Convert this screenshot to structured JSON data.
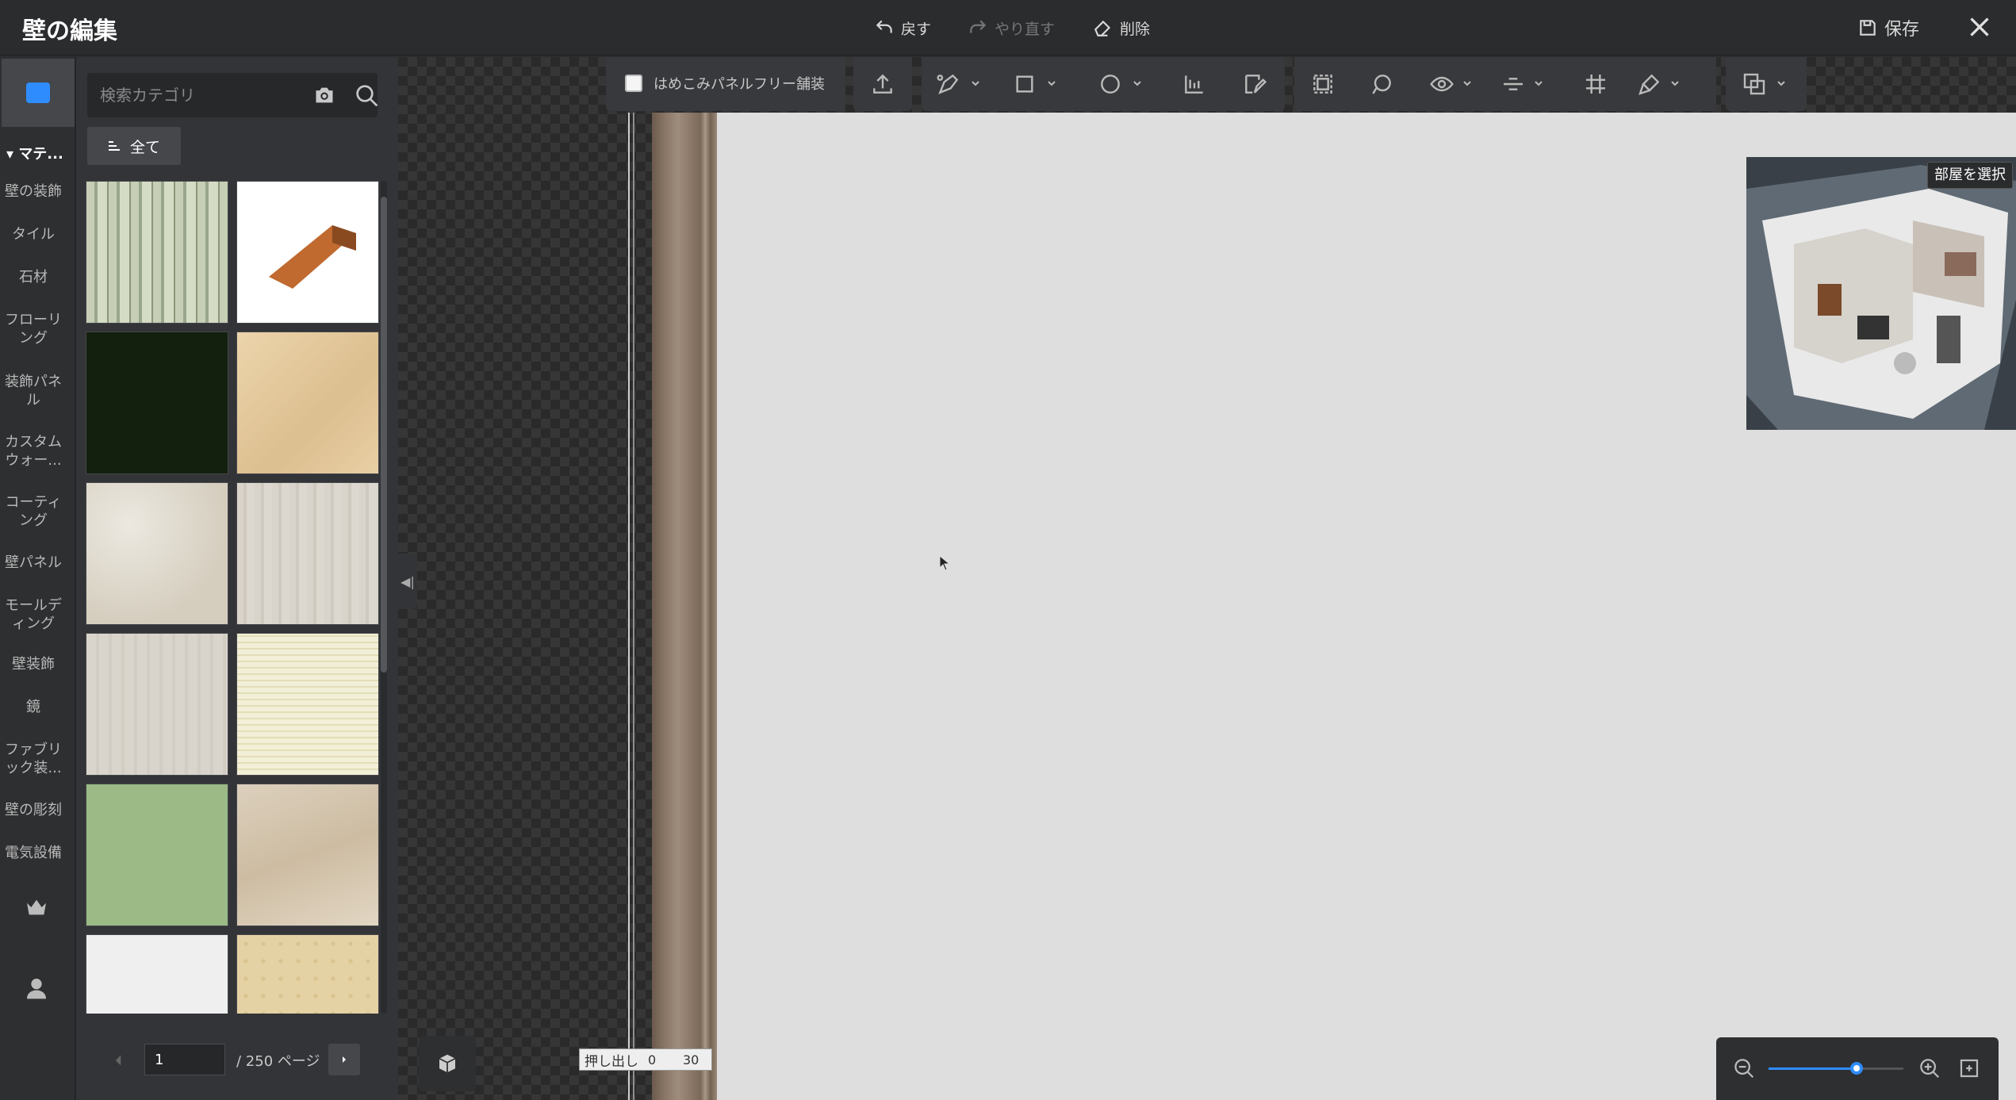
{
  "header": {
    "title": "壁の編集",
    "undo_label": "戻す",
    "redo_label": "やり直す",
    "delete_label": "削除",
    "save_label": "保存"
  },
  "sidebar": {
    "category_header": "マテ...",
    "categories": [
      "壁の装飾",
      "タイル",
      "石材",
      "フローリ\nング",
      "装飾パネ\nル",
      "カスタム\nウォー...",
      "コーティ\nング",
      "壁パネル",
      "モールデ\nィング",
      "壁装飾",
      "鏡",
      "ファブリ\nック装...",
      "壁の彫刻",
      "電気設備"
    ]
  },
  "materials": {
    "search_placeholder": "検索カテゴリ",
    "filter_label": "全て",
    "tiles": [
      {
        "name": "birch-wood",
        "color": "#b8c2aa"
      },
      {
        "name": "wood-baseboard",
        "color": "#ffffff"
      },
      {
        "name": "dark-green",
        "color": "#14200e"
      },
      {
        "name": "light-oak",
        "color": "#e6cba0"
      },
      {
        "name": "beige-stone",
        "color": "#ddd7cb"
      },
      {
        "name": "grey-wood",
        "color": "#d6d1c8"
      },
      {
        "name": "pale-wood",
        "color": "#d8d3c9"
      },
      {
        "name": "check-fabric",
        "color": "#f2efd8"
      },
      {
        "name": "green-plaster",
        "color": "#9bba86"
      },
      {
        "name": "marble-tile",
        "color": "#d8cbb6"
      },
      {
        "name": "white-plaster",
        "color": "#efefef"
      },
      {
        "name": "damask-wallpaper",
        "color": "#e4d1a4"
      }
    ],
    "pagination": {
      "current": "1",
      "total_label": "/ 250 ページ"
    }
  },
  "toolbar": {
    "inlay_panel_label": "はめこみパネルフリー舗装"
  },
  "minimap": {
    "room_select_label": "部屋を選択"
  },
  "extrude": {
    "label": "押し出し",
    "value_a": "0",
    "value_b": "30"
  },
  "zoom": {
    "level": 0.65
  },
  "colors": {
    "accent": "#2f8cff",
    "wall": "#8a7666",
    "canvas": "#dedede"
  }
}
